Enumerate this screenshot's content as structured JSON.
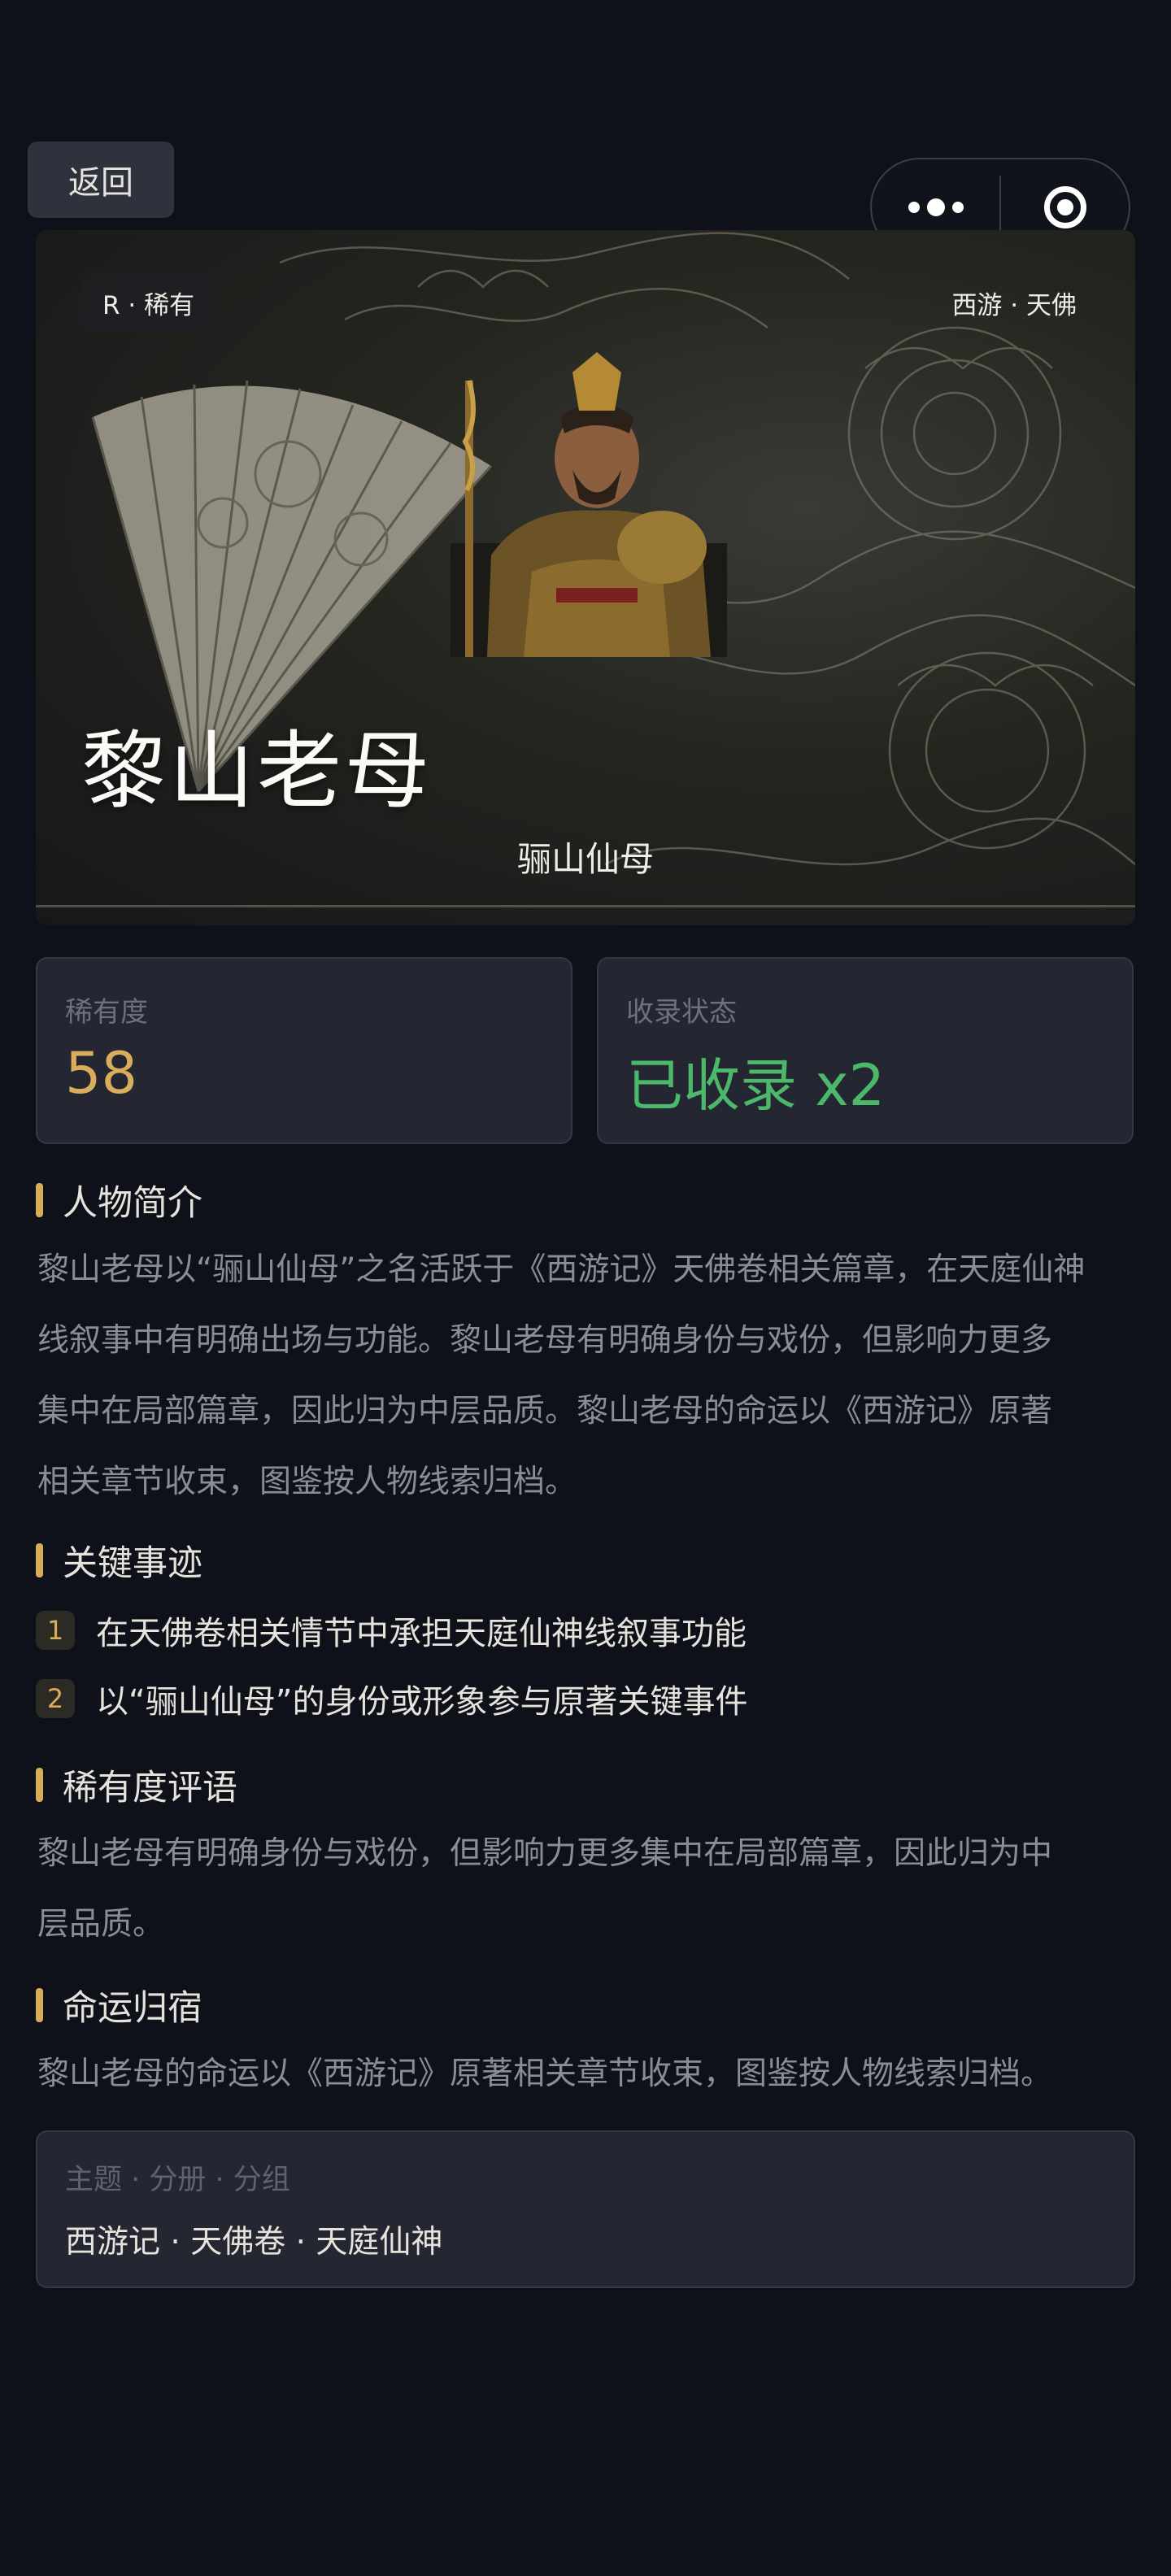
{
  "nav": {
    "back_label": "返回"
  },
  "hero": {
    "rarity_badge": "R · 稀有",
    "series_badge": "西游 · 天佛",
    "name": "黎山老母",
    "alias": "骊山仙母"
  },
  "stats": {
    "rarity": {
      "label": "稀有度",
      "value": "58",
      "color": "#d9ad5c"
    },
    "collection": {
      "label": "收录状态",
      "value": "已收录 x2",
      "color": "#4cb96a"
    }
  },
  "sections": {
    "intro": {
      "title": "人物简介",
      "lines": [
        "黎山老母以“骊山仙母”之名活跃于《西游记》天佛卷相关篇章，在天庭仙神",
        "线叙事中有明确出场与功能。黎山老母有明确身份与戏份，但影响力更多",
        "集中在局部篇章，因此归为中层品质。黎山老母的命运以《西游记》原著",
        "相关章节收束，图鉴按人物线索归档。"
      ]
    },
    "events": {
      "title": "关键事迹",
      "items": [
        {
          "num": "1",
          "text": "在天佛卷相关情节中承担天庭仙神线叙事功能"
        },
        {
          "num": "2",
          "text": "以“骊山仙母”的身份或形象参与原著关键事件"
        }
      ]
    },
    "rarity_comment": {
      "title": "稀有度评语",
      "lines": [
        "黎山老母有明确身份与戏份，但影响力更多集中在局部篇章，因此归为中",
        "层品质。"
      ]
    },
    "fate": {
      "title": "命运归宿",
      "lines": [
        "黎山老母的命运以《西游记》原著相关章节收束，图鉴按人物线索归档。"
      ]
    }
  },
  "meta": {
    "label": "主题 · 分册 · 分组",
    "value": "西游记 · 天佛卷 · 天庭仙神"
  },
  "colors": {
    "accent": "#d8ad5a",
    "background": "#0e111a",
    "card": "#242732"
  }
}
